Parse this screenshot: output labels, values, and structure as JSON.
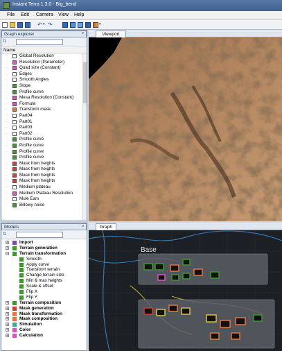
{
  "app": {
    "title": "Instant Terra 1.3.0 - Big_bend"
  },
  "menu": {
    "items": [
      "File",
      "Edit",
      "Camera",
      "View",
      "Help"
    ]
  },
  "toolbar": {
    "icons": [
      "new-file-icon",
      "open-folder-icon",
      "save-icon",
      "save-all-icon",
      "undo-icon",
      "undo-dropdown-icon",
      "redo-icon",
      "view-cube-icon",
      "view-front-icon",
      "view-top-icon",
      "render-icon",
      "color-palette-icon"
    ]
  },
  "graph_explorer": {
    "title": "Graph explorer",
    "pin": "ᵖ",
    "sort_label": "⇅",
    "search_value": "",
    "column_header": "Name",
    "items": [
      {
        "label": "Global Resolution",
        "color": "#ffffff"
      },
      {
        "label": "Resolution (Parameter)",
        "color": "#e04fc8"
      },
      {
        "label": "Quad size (Constant)",
        "color": "#e04fc8"
      },
      {
        "label": "Edges",
        "color": "#ffffff"
      },
      {
        "label": "Smooth Angles",
        "color": "#ffffff"
      },
      {
        "label": "Slope",
        "color": "#3b9a2a"
      },
      {
        "label": "Profile curve",
        "color": "#3b9a2a"
      },
      {
        "label": "Mesa Resolution (Constant)",
        "color": "#e04fc8"
      },
      {
        "label": "Formula",
        "color": "#e04fc8"
      },
      {
        "label": "Transform mask",
        "color": "#e8763a"
      },
      {
        "label": "Part04",
        "color": "#ffffff"
      },
      {
        "label": "Part01",
        "color": "#ffffff"
      },
      {
        "label": "Part03",
        "color": "#ffffff"
      },
      {
        "label": "Part02",
        "color": "#ffffff"
      },
      {
        "label": "Profile curve",
        "color": "#3b9a2a"
      },
      {
        "label": "Profile curve",
        "color": "#3b9a2a"
      },
      {
        "label": "Profile curve",
        "color": "#3b9a2a"
      },
      {
        "label": "Profile curve",
        "color": "#3b9a2a"
      },
      {
        "label": "Mask from heights",
        "color": "#d7392e"
      },
      {
        "label": "Mask from heights",
        "color": "#d7392e"
      },
      {
        "label": "Mask from heights",
        "color": "#d7392e"
      },
      {
        "label": "Mask from heights",
        "color": "#d7392e"
      },
      {
        "label": "Medium plateau",
        "color": "#ffffff"
      },
      {
        "label": "Medium Plateau Resolution",
        "color": "#e04fc8"
      },
      {
        "label": "Mule Ears",
        "color": "#ffffff"
      },
      {
        "label": "Billowy noise",
        "color": "#3b9a2a"
      }
    ]
  },
  "viewport": {
    "tab_label": "Viewport"
  },
  "models": {
    "title": "Models",
    "pin": "ᵖ",
    "sort_label": "⇅",
    "search_value": "",
    "items": [
      {
        "label": "Import",
        "color": "#7b4aa8",
        "category": true,
        "toggle": "+"
      },
      {
        "label": "Terrain generation",
        "color": "#3b9a2a",
        "category": true,
        "toggle": "+"
      },
      {
        "label": "Terrain transformation",
        "color": "#3b9a2a",
        "category": true,
        "toggle": "−"
      },
      {
        "label": "Smooth",
        "color": "#3b9a2a",
        "category": false
      },
      {
        "label": "Apply curve",
        "color": "#3b9a2a",
        "category": false
      },
      {
        "label": "Transform terrain",
        "color": "#3b9a2a",
        "category": false
      },
      {
        "label": "Change terrain size",
        "color": "#3b9a2a",
        "category": false
      },
      {
        "label": "Min & max heights",
        "color": "#3b9a2a",
        "category": false
      },
      {
        "label": "Scale & offset",
        "color": "#3b9a2a",
        "category": false
      },
      {
        "label": "Flip X",
        "color": "#3b9a2a",
        "category": false
      },
      {
        "label": "Flip Y",
        "color": "#3b9a2a",
        "category": false
      },
      {
        "label": "Terrain composition",
        "color": "#3b9a2a",
        "category": true,
        "toggle": "+"
      },
      {
        "label": "Mask generation",
        "color": "#d7392e",
        "category": true,
        "toggle": "+"
      },
      {
        "label": "Mask transformation",
        "color": "#e8763a",
        "category": true,
        "toggle": "+"
      },
      {
        "label": "Mask composition",
        "color": "#e8763a",
        "category": true,
        "toggle": "+"
      },
      {
        "label": "Simulation",
        "color": "#3aa6a0",
        "category": true,
        "toggle": "+"
      },
      {
        "label": "Color",
        "color": "#d94fc4",
        "category": true,
        "toggle": "+"
      },
      {
        "label": "Calculation",
        "color": "#d94fc4",
        "category": true,
        "toggle": "+"
      }
    ]
  },
  "graph": {
    "tab_label": "Graph",
    "group_label": "Base"
  },
  "colors": {
    "accent": "#3e5f8e",
    "terrain_green": "#3b9a2a",
    "mask_red": "#d7392e",
    "mask_orange": "#e8763a",
    "param_pink": "#e04fc8"
  }
}
